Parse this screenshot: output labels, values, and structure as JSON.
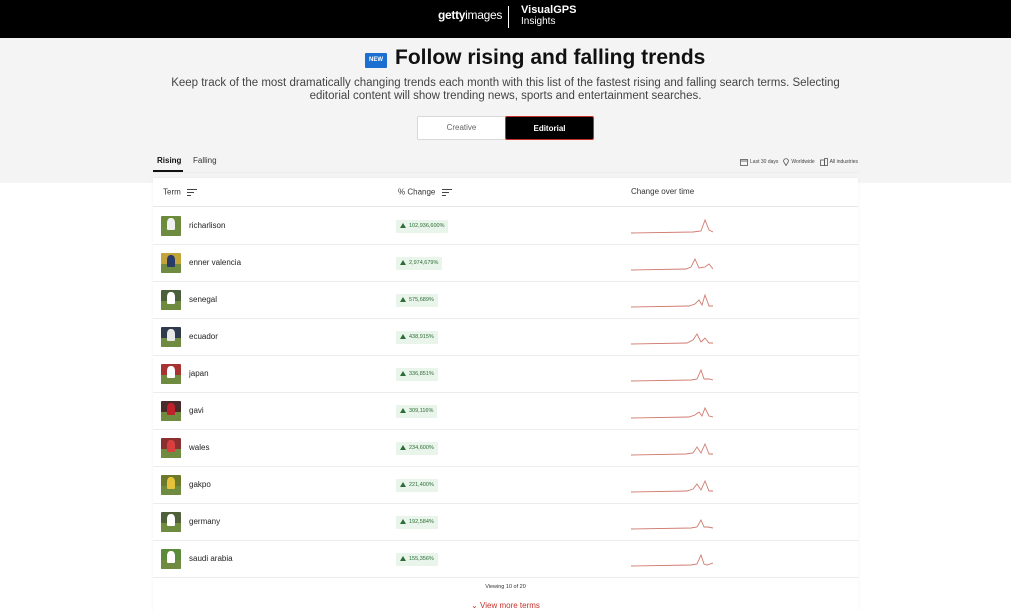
{
  "header": {
    "brand_bold": "getty",
    "brand_rest": "images",
    "vgps_line1": "VisualGPS",
    "vgps_line2": "Insights"
  },
  "hero": {
    "badge": "NEW",
    "title": "Follow rising and falling trends",
    "subtitle": "Keep track of the most dramatically changing trends each month with this list of the fastest rising and falling search terms. Selecting editorial content will show trending news, sports and entertainment searches."
  },
  "toggle": {
    "creative": "Creative",
    "editorial": "Editorial",
    "selected": "Editorial"
  },
  "tabs": {
    "rising": "Rising",
    "falling": "Falling",
    "active": "Rising"
  },
  "filters": {
    "period": "Last 30 days",
    "region": "Worldwide",
    "industry": "All industries",
    "icons": [
      "calendar-icon",
      "location-pin-icon",
      "building-icon"
    ]
  },
  "table": {
    "columns": {
      "term": "Term",
      "change": "% Change",
      "time": "Change over time"
    },
    "rows": [
      {
        "term": "richarlison",
        "change": "102,936,600%"
      },
      {
        "term": "enner valencia",
        "change": "2,974,679%"
      },
      {
        "term": "senegal",
        "change": "575,689%"
      },
      {
        "term": "ecuador",
        "change": "438,915%"
      },
      {
        "term": "japan",
        "change": "336,851%"
      },
      {
        "term": "gavi",
        "change": "309,116%"
      },
      {
        "term": "wales",
        "change": "234,600%"
      },
      {
        "term": "gakpo",
        "change": "221,400%"
      },
      {
        "term": "germany",
        "change": "192,584%"
      },
      {
        "term": "saudi arabia",
        "change": "155,356%"
      }
    ]
  },
  "footer": {
    "count": "Viewing 10 of 20",
    "more": "View more terms"
  },
  "colors": {
    "accent": "#c5302a",
    "badge": "#1a6fd1",
    "positive": "#2c6e36",
    "pill_bg": "#e9f4ea"
  }
}
